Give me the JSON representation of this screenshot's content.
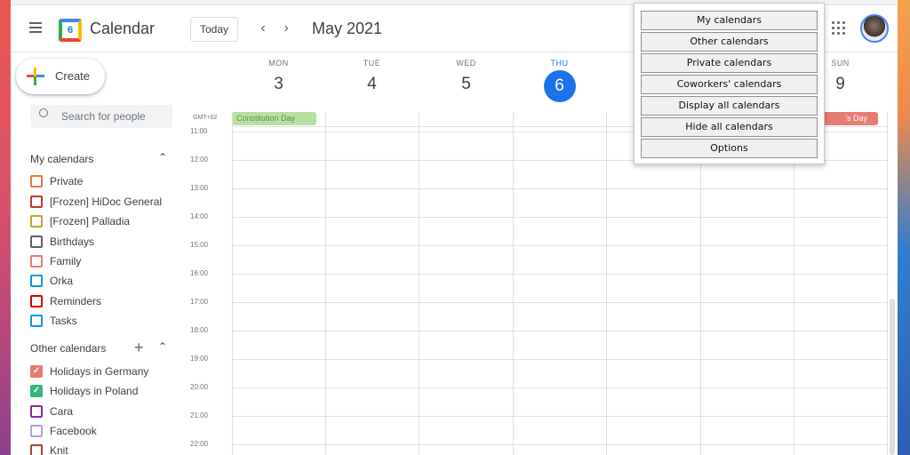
{
  "header": {
    "app_name": "Calendar",
    "logo_day": "6",
    "today_label": "Today",
    "prev_icon": "chevron-left-icon",
    "next_icon": "chevron-right-icon",
    "month_title": "May 2021"
  },
  "create": {
    "label": "Create"
  },
  "search": {
    "placeholder": "Search for people"
  },
  "my_calendars": {
    "title": "My calendars",
    "items": [
      {
        "label": "Private",
        "color": "#e67c3c",
        "checked": false
      },
      {
        "label": "[Frozen] HiDoc General",
        "color": "#c0392b",
        "checked": false
      },
      {
        "label": "[Frozen] Palladia",
        "color": "#c9a227",
        "checked": false
      },
      {
        "label": "Birthdays",
        "color": "#616161",
        "checked": false
      },
      {
        "label": "Family",
        "color": "#e67c73",
        "checked": false
      },
      {
        "label": "Orka",
        "color": "#039be5",
        "checked": false
      },
      {
        "label": "Reminders",
        "color": "#d50000",
        "checked": false
      },
      {
        "label": "Tasks",
        "color": "#039be5",
        "checked": false
      }
    ]
  },
  "other_calendars": {
    "title": "Other calendars",
    "items": [
      {
        "label": "Holidays in Germany",
        "color": "#e67c73",
        "checked": true
      },
      {
        "label": "Holidays in Poland",
        "color": "#33b679",
        "checked": true
      },
      {
        "label": "Cara",
        "color": "#8e24aa",
        "checked": false
      },
      {
        "label": "Facebook",
        "color": "#b39ddb",
        "checked": false
      },
      {
        "label": "Knit",
        "color": "#a1463a",
        "checked": false
      }
    ]
  },
  "week": {
    "days": [
      {
        "dow": "MON",
        "num": "3",
        "today": false
      },
      {
        "dow": "TUE",
        "num": "4",
        "today": false
      },
      {
        "dow": "WED",
        "num": "5",
        "today": false
      },
      {
        "dow": "THU",
        "num": "6",
        "today": true
      },
      {
        "dow": "SUN",
        "num": "9",
        "today": false
      }
    ],
    "timezone": "GMT+02",
    "hours": [
      "11:00",
      "12:00",
      "13:00",
      "14:00",
      "15:00",
      "16:00",
      "17:00",
      "18:00",
      "19:00",
      "20:00",
      "21:00",
      "22:00"
    ],
    "allday_events": [
      {
        "label": "Constitution Day",
        "color": "#b7e1a1",
        "text_color": "#5f8f46"
      },
      {
        "label": "'s Day",
        "color": "#e67c73",
        "text_color": "#ffffff"
      }
    ]
  },
  "dropdown": {
    "items": [
      "My calendars",
      "Other calendars",
      "Private calendars",
      "Coworkers' calendars",
      "Display all calendars",
      "Hide all calendars",
      "Options"
    ]
  },
  "colors": {
    "accent": "#1a73e8"
  }
}
